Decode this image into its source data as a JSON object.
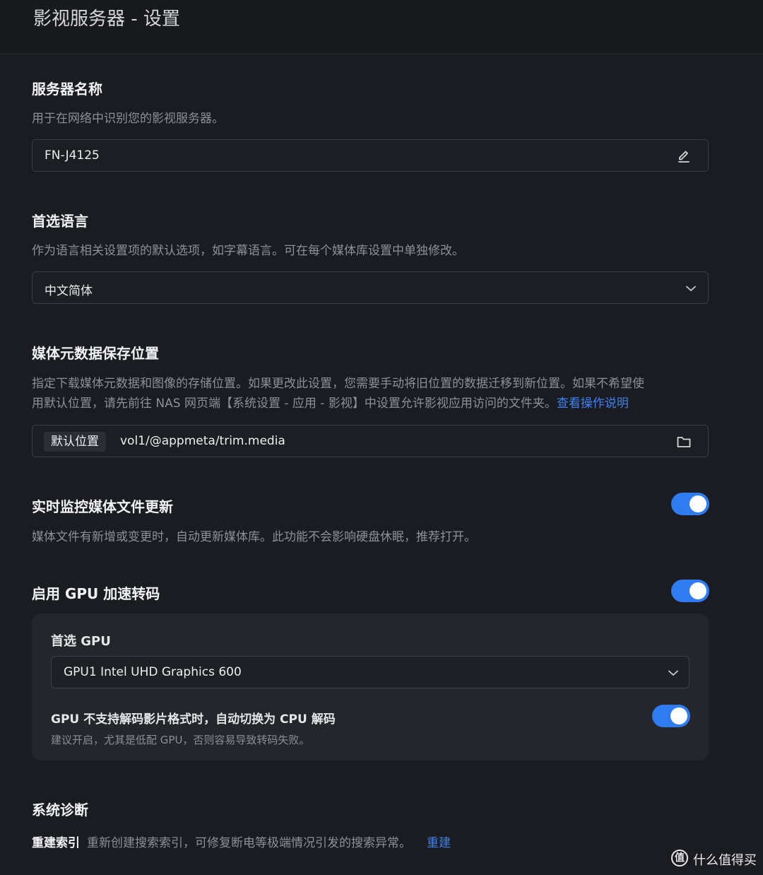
{
  "page": {
    "title": "影视服务器 - 设置"
  },
  "server_name": {
    "title": "服务器名称",
    "description": "用于在网络中识别您的影视服务器。",
    "value": "FN-J4125",
    "icon": "edit-icon"
  },
  "language": {
    "title": "首选语言",
    "description": "作为语言相关设置项的默认选项，如字幕语言。可在每个媒体库设置中单独修改。",
    "selected": "中文简体",
    "icon": "chevron-down-icon"
  },
  "metadata": {
    "title": "媒体元数据保存位置",
    "description_line1": "指定下载媒体元数据和图像的存储位置。如果更改此设置，您需要手动将旧位置的数据迁移到新位置。如果不希望使",
    "description_line2": "用默认位置，请先前往 NAS 网页端【系统设置 - 应用 - 影视】中设置允许影视应用访问的文件夹。",
    "help_link": "查看操作说明",
    "location_tag": "默认位置",
    "path": "vol1/@appmeta/trim.media",
    "icon": "folder-icon"
  },
  "monitor": {
    "title": "实时监控媒体文件更新",
    "description": "媒体文件有新增或变更时，自动更新媒体库。此功能不会影响硬盘休眠，推荐打开。",
    "enabled": true
  },
  "gpu": {
    "title": "启用 GPU 加速转码",
    "enabled": true,
    "preferred_label": "首选 GPU",
    "preferred_value": "GPU1 Intel UHD Graphics 600",
    "fallback_label": "GPU 不支持解码影片格式时，自动切换为 CPU 解码",
    "fallback_description": "建议开启，尤其是低配 GPU，否则容易导致转码失败。",
    "fallback_enabled": true
  },
  "diagnostics": {
    "title": "系统诊断",
    "rebuild_label": "重建索引",
    "rebuild_description": "重新创建搜索索引，可修复断电等极端情况引发的搜索异常。",
    "rebuild_link": "重建"
  },
  "watermark": {
    "text": "什么值得买",
    "glyph": "值"
  },
  "colors": {
    "accent": "#2f7bf0",
    "link": "#3d82f0",
    "background": "#1a1c21",
    "panel": "#24262c"
  }
}
